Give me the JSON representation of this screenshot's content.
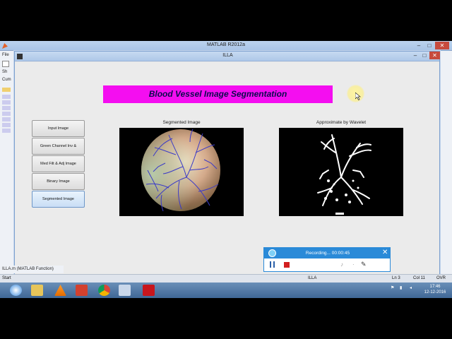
{
  "matlab_window": {
    "title": "MATLAB  R2012a",
    "menu_file": "File"
  },
  "figure": {
    "title": "ILLA",
    "headline": "Blood Vessel Image Segmentation",
    "buttons": [
      {
        "label": "Input Image"
      },
      {
        "label": "Green Channel Inv & Enhance"
      },
      {
        "label": "Med Filt & Adj Image"
      },
      {
        "label": "Binary Image"
      },
      {
        "label": "Segmented Image"
      }
    ],
    "left_panel_label": "Segmented Image",
    "right_panel_label": "Approximate by Wavelet"
  },
  "recorder": {
    "status": "Recording... 00:00:45"
  },
  "status_bar": {
    "start": "Start",
    "file": "ILLA",
    "ln": "Ln   3",
    "col": "Col   11",
    "mode": "OVR"
  },
  "file_panel": {
    "item": "ILLA.m (MATLAB Function)"
  },
  "left_strip": {
    "items": [
      "Sh",
      "Cum"
    ]
  },
  "clock": {
    "time": "17:46",
    "date": "12-12-2016"
  },
  "colors": {
    "headline_bg": "#f40ef0",
    "headline_text": "#0b0b4d",
    "vessel_overlay": "#3a3ac8"
  }
}
